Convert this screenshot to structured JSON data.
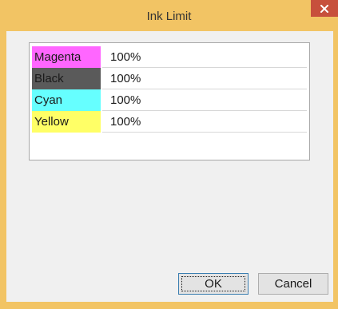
{
  "window": {
    "title": "Ink Limit",
    "close_icon": "close-icon"
  },
  "inks": [
    {
      "name": "Magenta",
      "value": "100%",
      "color": "#ff66ff"
    },
    {
      "name": "Black",
      "value": "100%",
      "color": "#5a5a5a"
    },
    {
      "name": "Cyan",
      "value": "100%",
      "color": "#66ffff"
    },
    {
      "name": "Yellow",
      "value": "100%",
      "color": "#ffff66"
    }
  ],
  "buttons": {
    "ok_label": "OK",
    "cancel_label": "Cancel"
  },
  "colors": {
    "title_bar": "#f2c464",
    "close_button": "#c7503c",
    "dialog_background": "#f0f0f0"
  }
}
